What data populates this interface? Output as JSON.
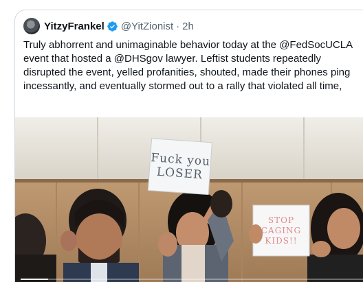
{
  "tweet": {
    "display_name": "YitzyFrankel",
    "handle": "@YitZionist",
    "separator": "·",
    "time": "2h",
    "text": "Truly abhorrent and unimaginable behavior today at the @FedSocUCLA event that hosted a @DHSgov lawyer. Leftist students repeatedly disrupted the event, yelled profanities, shouted, made their phones ping incessantly, and eventually stormed out to a rally that violated all time,"
  },
  "media": {
    "sign_left_text": "Fuck you LOSER",
    "sign_right_text": "STOP CAGING KIDS!!",
    "video_progress": 0.08
  },
  "icons": {
    "verified": "verified-badge-icon"
  },
  "colors": {
    "text": "#0f1419",
    "secondary": "#536471",
    "verified": "#1d9bf0",
    "border": "#cfd9de"
  }
}
